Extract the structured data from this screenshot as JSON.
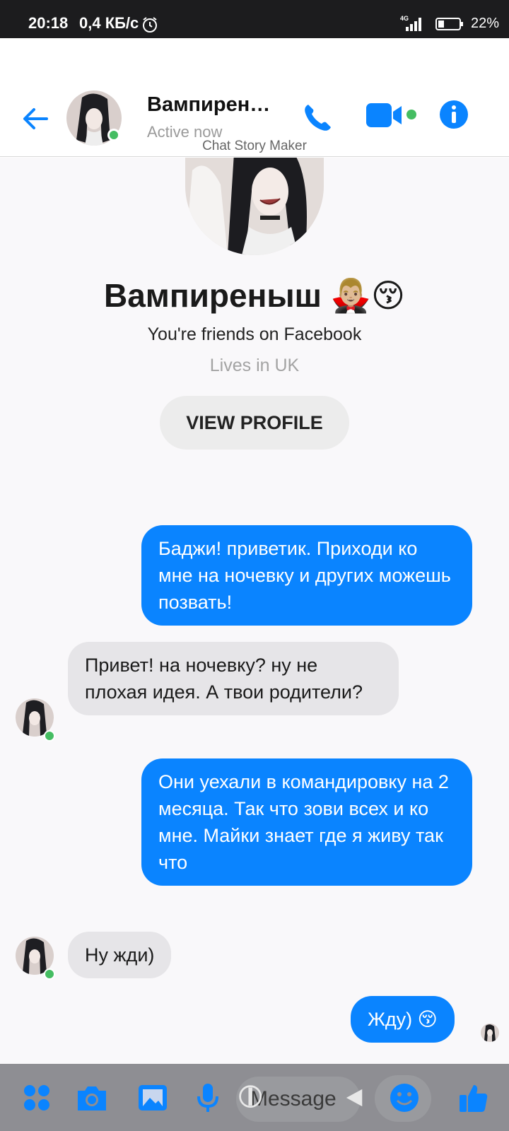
{
  "status_bar": {
    "time": "20:18",
    "speed": "0,4 КБ/с",
    "network": "4G",
    "battery": "22%"
  },
  "header": {
    "name": "Вампиреныш…",
    "status": "Active now",
    "watermark": "Chat Story Maker"
  },
  "profile": {
    "name": "Вампиреныш 🧛🏼‍♂️😚",
    "friends": "You're friends on Facebook",
    "lives": "Lives in UK",
    "view_profile_label": "VIEW PROFILE"
  },
  "messages": [
    {
      "from": "me",
      "text": "Баджи! приветик. Приходи ко мне на ночевку и других можешь позвать!"
    },
    {
      "from": "them",
      "text": "Привет! на ночевку? ну не плохая идея. А твои родители?"
    },
    {
      "from": "me",
      "text": "Они уехали в командировку на 2 месяца. Так что зови всех и ко мне. Майки знает где я живу так что"
    },
    {
      "from": "them",
      "text": "Ну жди)"
    },
    {
      "from": "me",
      "text": "Жду) 😚"
    }
  ],
  "composer": {
    "placeholder": "Message"
  },
  "colors": {
    "accent": "#0a84ff",
    "online": "#45bd62",
    "incoming_bubble": "#e6e5e8"
  },
  "icons": [
    "back-arrow-icon",
    "phone-icon",
    "video-camera-icon",
    "info-icon",
    "apps-grid-icon",
    "camera-icon",
    "gallery-icon",
    "microphone-icon",
    "emoji-icon",
    "thumbs-up-icon"
  ]
}
